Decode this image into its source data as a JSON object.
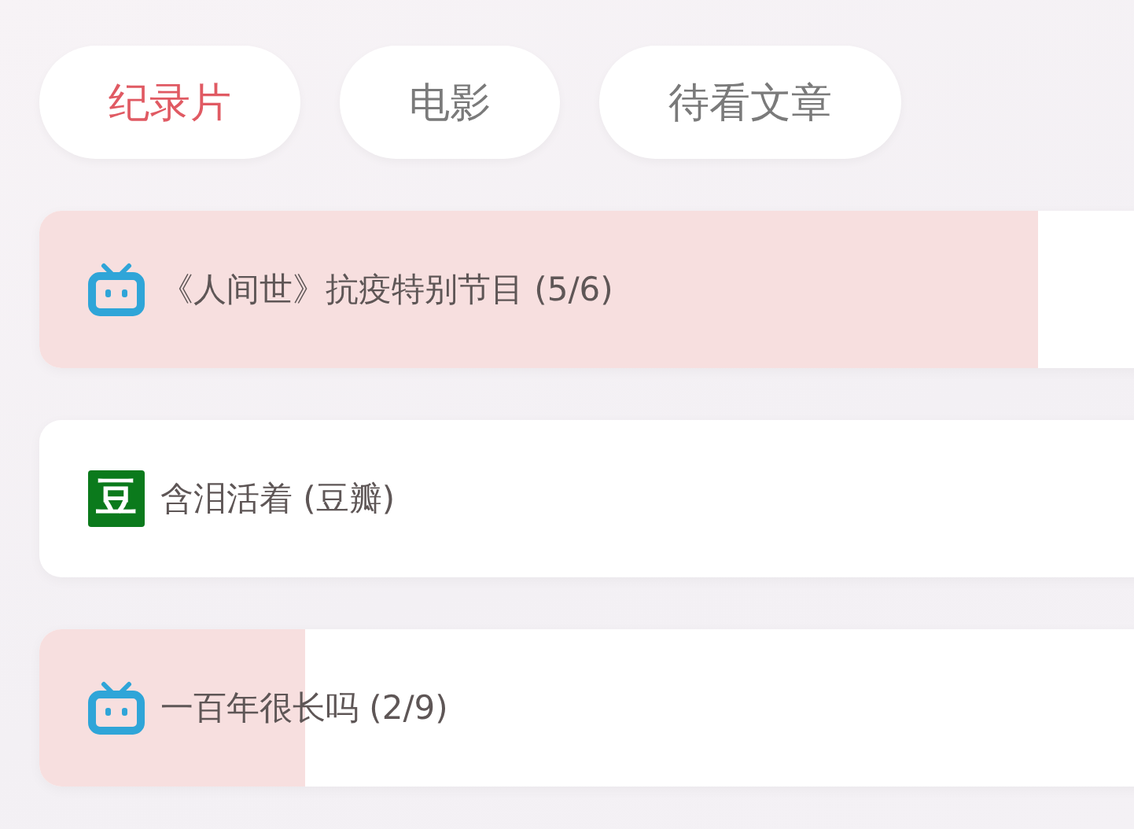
{
  "tabs": [
    {
      "label": "纪录片",
      "selected": true
    },
    {
      "label": "电影",
      "selected": false
    },
    {
      "label": "待看文章",
      "selected": false
    }
  ],
  "items": [
    {
      "kind": "tv",
      "title": "《人间世》抗疫特别节目 (5/6)",
      "level": 0.833
    },
    {
      "kind": "badge",
      "badge": "豆",
      "title": "含泪活着 (豆瓣)"
    },
    {
      "kind": "tv",
      "title": "一百年很长吗 (2/9)",
      "level": 0.222
    }
  ]
}
